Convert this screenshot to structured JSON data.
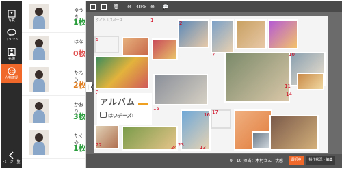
{
  "rail": {
    "items": [
      {
        "label": "写真"
      },
      {
        "label": "コメント"
      },
      {
        "label": "名簿"
      },
      {
        "label": "人物確認"
      }
    ],
    "back_label": "ページ一覧"
  },
  "members": [
    {
      "name": "ゆうき",
      "count": "1枚",
      "color": "#2a9d3c"
    },
    {
      "name": "はな",
      "count": "0枚",
      "color": "#e05252"
    },
    {
      "name": "たろう",
      "count": "2枚",
      "color": "#e07d1e"
    },
    {
      "name": "かおり",
      "count": "3枚",
      "color": "#2a9d3c"
    },
    {
      "name": "たくや",
      "count": "1枚",
      "color": "#2a9d3c"
    }
  ],
  "toolbar": {
    "zoom": "30%",
    "zoom_out": "縮小",
    "zoom_in": "拡大"
  },
  "editor": {
    "title": "タイトルスペース",
    "album_title": "アルバム",
    "album_subtitle": "はいチーズ!",
    "photo_numbers": [
      "1",
      "2",
      "3",
      "5",
      "7",
      "10",
      "11",
      "13",
      "14",
      "15",
      "16",
      "17",
      "22",
      "23",
      "24"
    ]
  },
  "status": {
    "page": "9 - 10 担当：木村さん",
    "state": "状態",
    "primary": "選択中",
    "secondary": "操作状況・編集"
  }
}
